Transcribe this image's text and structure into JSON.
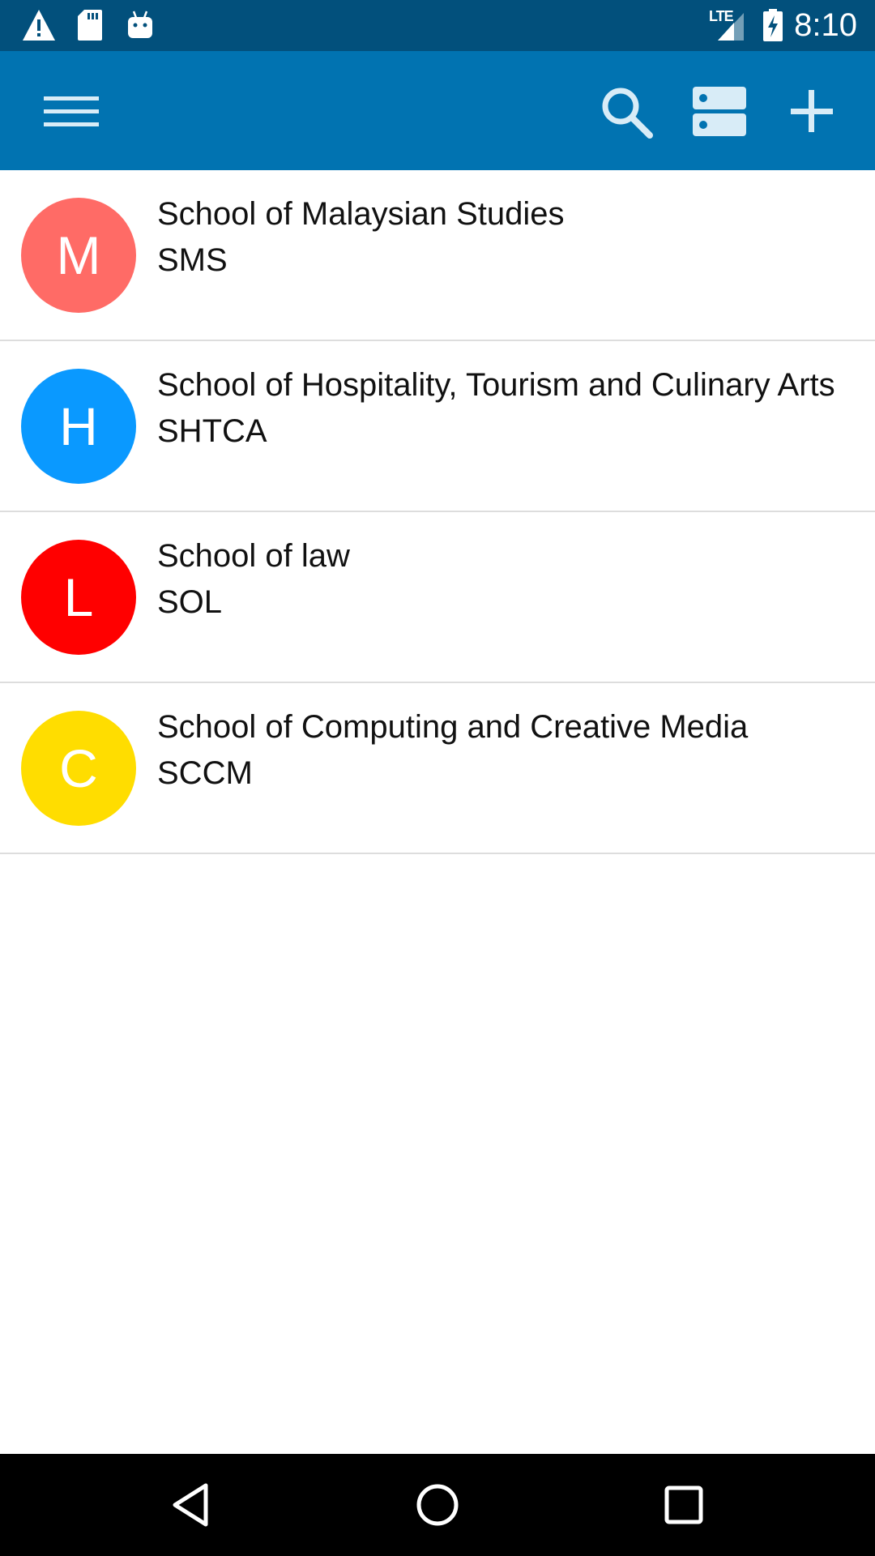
{
  "status_bar": {
    "time": "8:10",
    "network_label": "LTE",
    "icons": [
      "warning-icon",
      "sd-card-icon",
      "android-icon",
      "signal-icon",
      "battery-charging-icon"
    ]
  },
  "app_bar": {
    "icons": [
      "menu-icon",
      "search-icon",
      "storage-icon",
      "add-icon"
    ]
  },
  "schools": [
    {
      "initial": "M",
      "name": "School of Malaysian Studies",
      "code": "SMS",
      "color": "#ff6b66"
    },
    {
      "initial": "H",
      "name": "School of Hospitality, Tourism and Culinary Arts",
      "code": "SHTCA",
      "color": "#0a99ff"
    },
    {
      "initial": "L",
      "name": "School of law",
      "code": "SOL",
      "color": "#ff0000"
    },
    {
      "initial": "C",
      "name": "School of Computing and Creative Media",
      "code": "SCCM",
      "color": "#ffdd00"
    }
  ],
  "colors": {
    "status_bar": "#02507c",
    "app_bar": "#0173b1",
    "divider": "#dddddd"
  },
  "nav_bar": {
    "buttons": [
      "back-icon",
      "home-icon",
      "recents-icon"
    ]
  }
}
